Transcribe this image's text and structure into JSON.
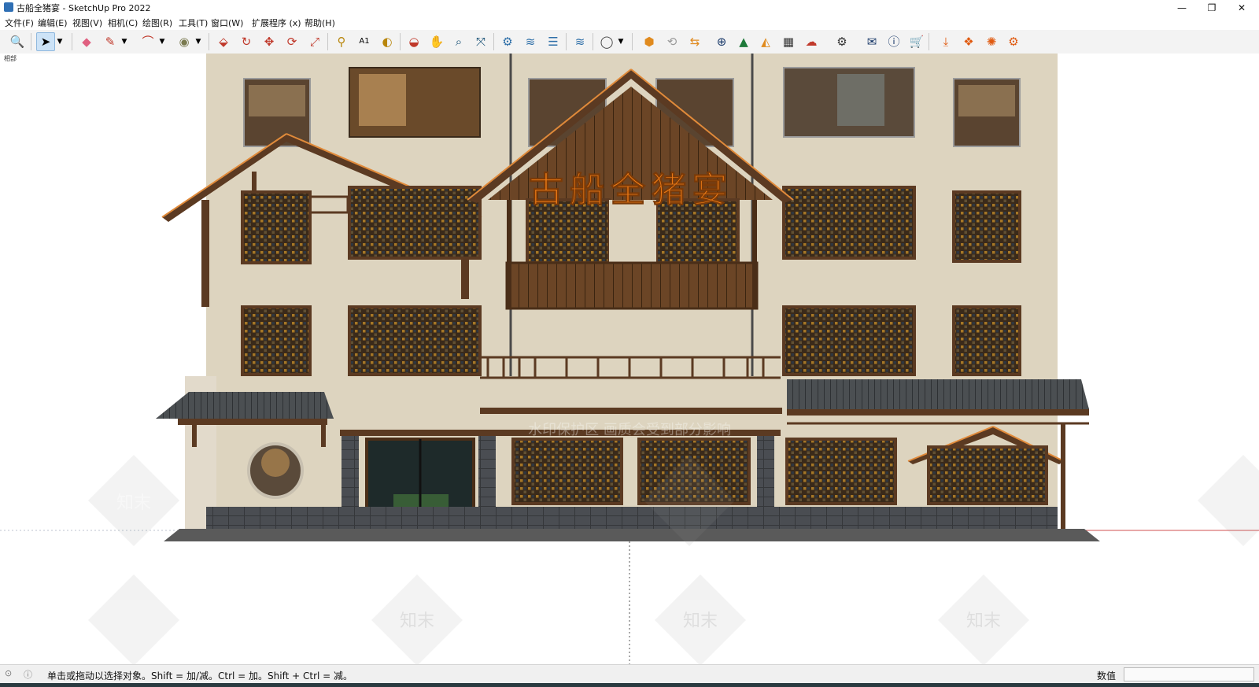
{
  "window": {
    "title": "古船全猪宴 - SketchUp Pro 2022",
    "minimize_label": "—",
    "maximize_label": "❐",
    "close_label": "✕"
  },
  "menu": [
    {
      "label": "文件(F)"
    },
    {
      "label": "编辑(E)"
    },
    {
      "label": "视图(V)"
    },
    {
      "label": "相机(C)"
    },
    {
      "label": "绘图(R)"
    },
    {
      "label": "工具(T)"
    },
    {
      "label": "窗口(W)"
    },
    {
      "label": "扩展程序 (x)"
    },
    {
      "label": "帮助(H)"
    }
  ],
  "toolbar": {
    "tools": [
      {
        "icon": "zoom-icon"
      },
      {
        "icon": "select-arrow-icon"
      },
      {
        "icon": "dropdown-arrow-icon"
      },
      {
        "icon": "eraser-icon"
      },
      {
        "icon": "pencil-icon"
      },
      {
        "icon": "dropdown-arrow-icon"
      },
      {
        "icon": "arc-icon"
      },
      {
        "icon": "dropdown-arrow-icon"
      },
      {
        "icon": "paint-bucket-icon"
      },
      {
        "icon": "dropdown-arrow-icon"
      },
      {
        "icon": "push-pull-icon"
      },
      {
        "icon": "follow-me-icon"
      },
      {
        "icon": "move-icon"
      },
      {
        "icon": "rotate-icon"
      },
      {
        "icon": "scale-icon"
      },
      {
        "icon": "tape-measure-icon"
      },
      {
        "icon": "text-icon"
      },
      {
        "icon": "paint-icon"
      },
      {
        "icon": "orbit-icon"
      },
      {
        "icon": "pan-icon"
      },
      {
        "icon": "zoom-window-icon"
      },
      {
        "icon": "zoom-extents-icon"
      },
      {
        "icon": "geo-location-icon"
      },
      {
        "icon": "sandbox-icon"
      },
      {
        "icon": "layers-icon"
      },
      {
        "icon": "sandbox-tools-icon"
      },
      {
        "icon": "account-icon"
      },
      {
        "icon": "dropdown-arrow-icon"
      },
      {
        "icon": "warehouse-icon"
      },
      {
        "icon": "refresh-icon"
      },
      {
        "icon": "send-to-layout-icon"
      },
      {
        "icon": "add-location-icon"
      },
      {
        "icon": "tree-icon"
      },
      {
        "icon": "sunset-icon"
      },
      {
        "icon": "checker-icon"
      },
      {
        "icon": "upload-cloud-icon"
      },
      {
        "icon": "settings-gear-icon"
      },
      {
        "icon": "mail-icon"
      },
      {
        "icon": "info-icon"
      },
      {
        "icon": "cart-icon"
      },
      {
        "icon": "import-icon"
      },
      {
        "icon": "extension-icon"
      },
      {
        "icon": "render-icon"
      },
      {
        "icon": "render-settings-icon"
      }
    ]
  },
  "scene": {
    "label": "相部",
    "signboard_text": "古船全猪宴",
    "watermark_text": "水印保护区 画质会受到部分影响",
    "watermark_brand": "知末",
    "colors": {
      "wall": "#ddd4bf",
      "wood": "#5b3a22",
      "wood_light": "#7a4f2e",
      "roof_tile": "#4b4f52",
      "sign": "#f07c16",
      "stone_base": "#4a4d52",
      "ground": "#5a5a5a"
    }
  },
  "status": {
    "message": "单击或拖动以选择对象。Shift = 加/减。Ctrl = 加。Shift + Ctrl = 减。",
    "measurements_label": "数值",
    "measurements_value": ""
  }
}
